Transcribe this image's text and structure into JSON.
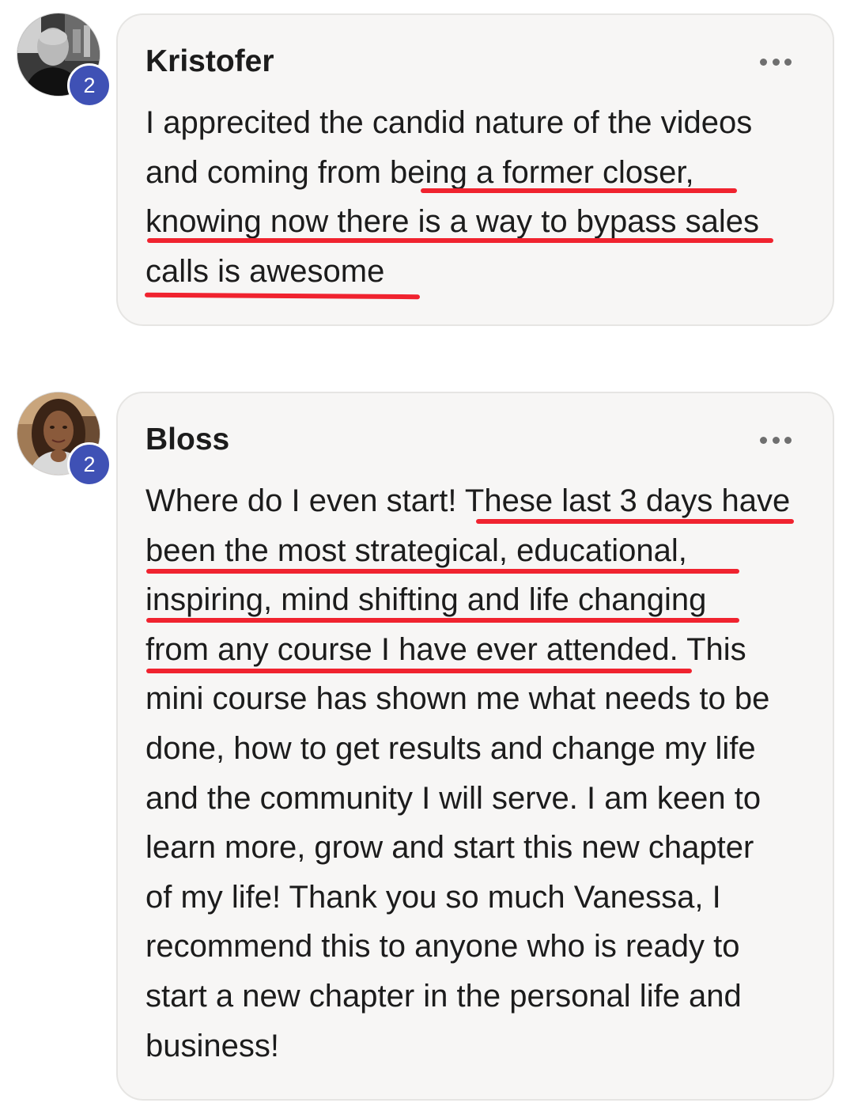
{
  "comments": [
    {
      "author": "Kristofer",
      "badge_count": "2",
      "more_icon": "more-horizontal-icon",
      "text_lines": [
        "I apprecited the candid nature of the videos",
        "and coming from being a former closer,",
        "knowing now there is a way to bypass sales",
        "calls is awesome"
      ]
    },
    {
      "author": "Bloss",
      "badge_count": "2",
      "more_icon": "more-horizontal-icon",
      "text_lines": [
        "Where do I even start! These last 3 days have",
        "been the most strategical, educational,",
        "inspiring, mind shifting and life changing",
        "from any course I have ever attended. This",
        "mini course has shown me what needs to be",
        "done, how to get results and change my life",
        "and the community I will serve. I am keen to",
        "learn more, grow and start this new chapter",
        "of my life! Thank you so much Vanessa, I",
        "recommend this to anyone who is ready to",
        "start a new chapter in the personal life and",
        "business!"
      ]
    }
  ],
  "colors": {
    "underline": "#f0232f",
    "badge": "#3f51b5",
    "bubble": "#f7f6f5"
  }
}
